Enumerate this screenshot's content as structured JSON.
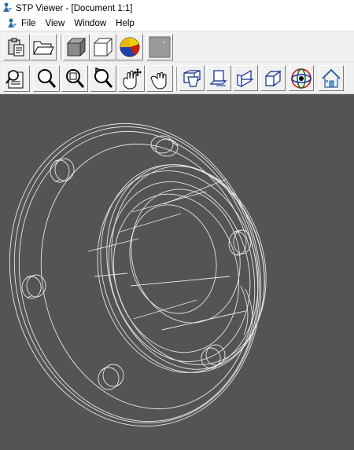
{
  "window": {
    "title": "STP Viewer - [Document 1:1]"
  },
  "menu": {
    "items": [
      "File",
      "View",
      "Window",
      "Help"
    ]
  },
  "toolbar_file": {
    "buttons": [
      "paste-icon",
      "open-folder-icon",
      "solid-box-icon",
      "wireframe-box-icon",
      "color-wheel-icon",
      "blank-swatch-icon"
    ]
  },
  "toolbar_view": {
    "buttons": [
      "print-preview-icon",
      "zoom-icon",
      "zoom-window-icon",
      "rotate-zoom-icon",
      "pan-hand-icon",
      "grab-hand-icon",
      "view-front-icon",
      "view-top-icon",
      "view-side-icon",
      "view-iso-icon",
      "orbit-icon",
      "home-view-icon"
    ]
  },
  "colors": {
    "viewport_bg": "#545454",
    "wire": "#e6e6e6"
  }
}
